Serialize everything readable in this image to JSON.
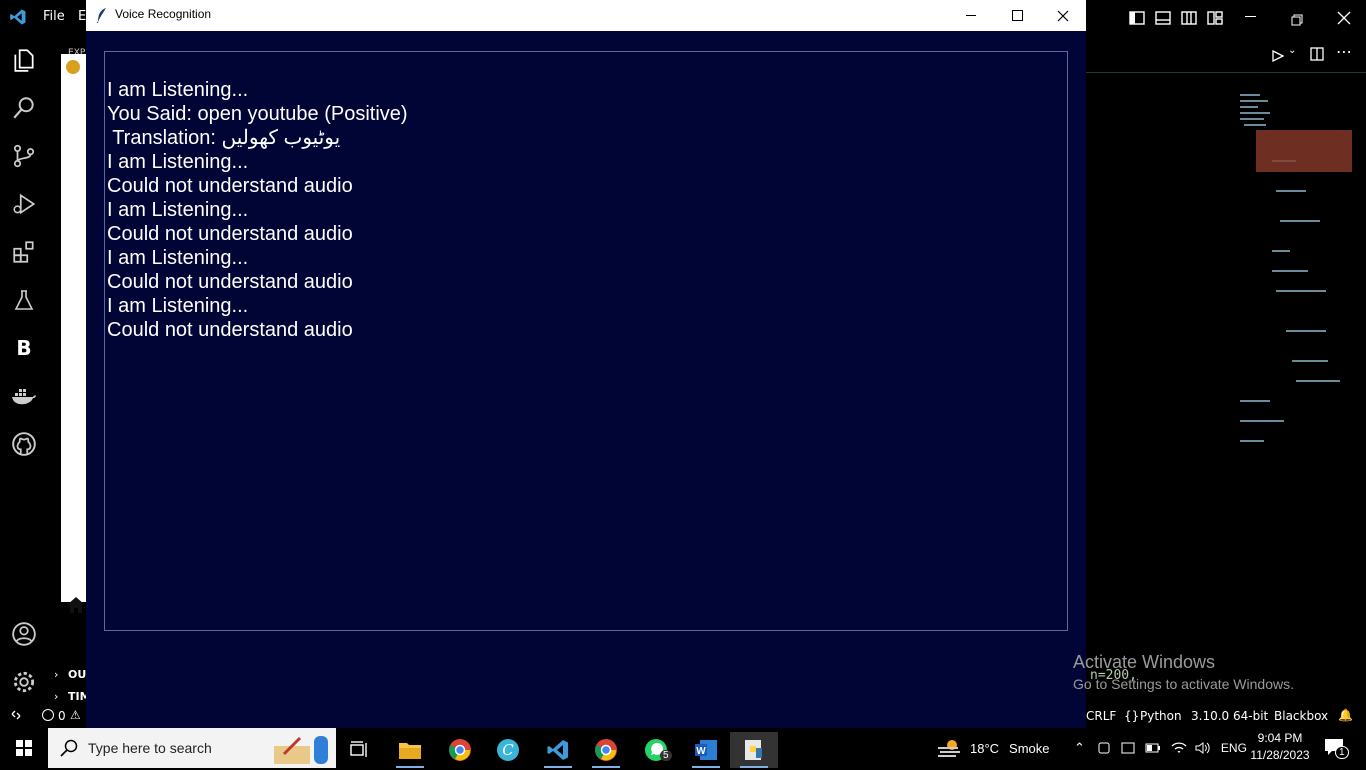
{
  "vscode": {
    "menu": {
      "file": "File",
      "edit_partial": "E"
    },
    "explorer": {
      "header_partial": "EXP",
      "outline": "OUT",
      "timeline": "TIM"
    },
    "status": {
      "errors": "0",
      "eol": "CRLF",
      "language": "Python",
      "interpreter": "3.10.0 64-bit",
      "extension": "Blackbox"
    },
    "code_fragment": "n=200,",
    "activity_b_label": "B"
  },
  "tk_window": {
    "title": "Voice Recognition",
    "lines": [
      "I am Listening...",
      "You Said: open youtube (Positive)",
      " Translation: یوٹیوب کھولیں",
      "I am Listening...",
      "Could not understand audio",
      "I am Listening...",
      "Could not understand audio",
      "I am Listening...",
      "Could not understand audio",
      "I am Listening...",
      "Could not understand audio"
    ]
  },
  "watermark": {
    "title": "Activate Windows",
    "subtitle": "Go to Settings to activate Windows."
  },
  "taskbar": {
    "search_placeholder": "Type here to search",
    "whatsapp_badge": "5",
    "weather": {
      "temp": "18°C",
      "condition": "Smoke"
    },
    "language": "ENG",
    "time": "9:04 PM",
    "date": "11/28/2023",
    "notification_count": "1"
  },
  "colors": {
    "tk_bg": "#000536",
    "vs_accent": "#3c9bd8"
  }
}
